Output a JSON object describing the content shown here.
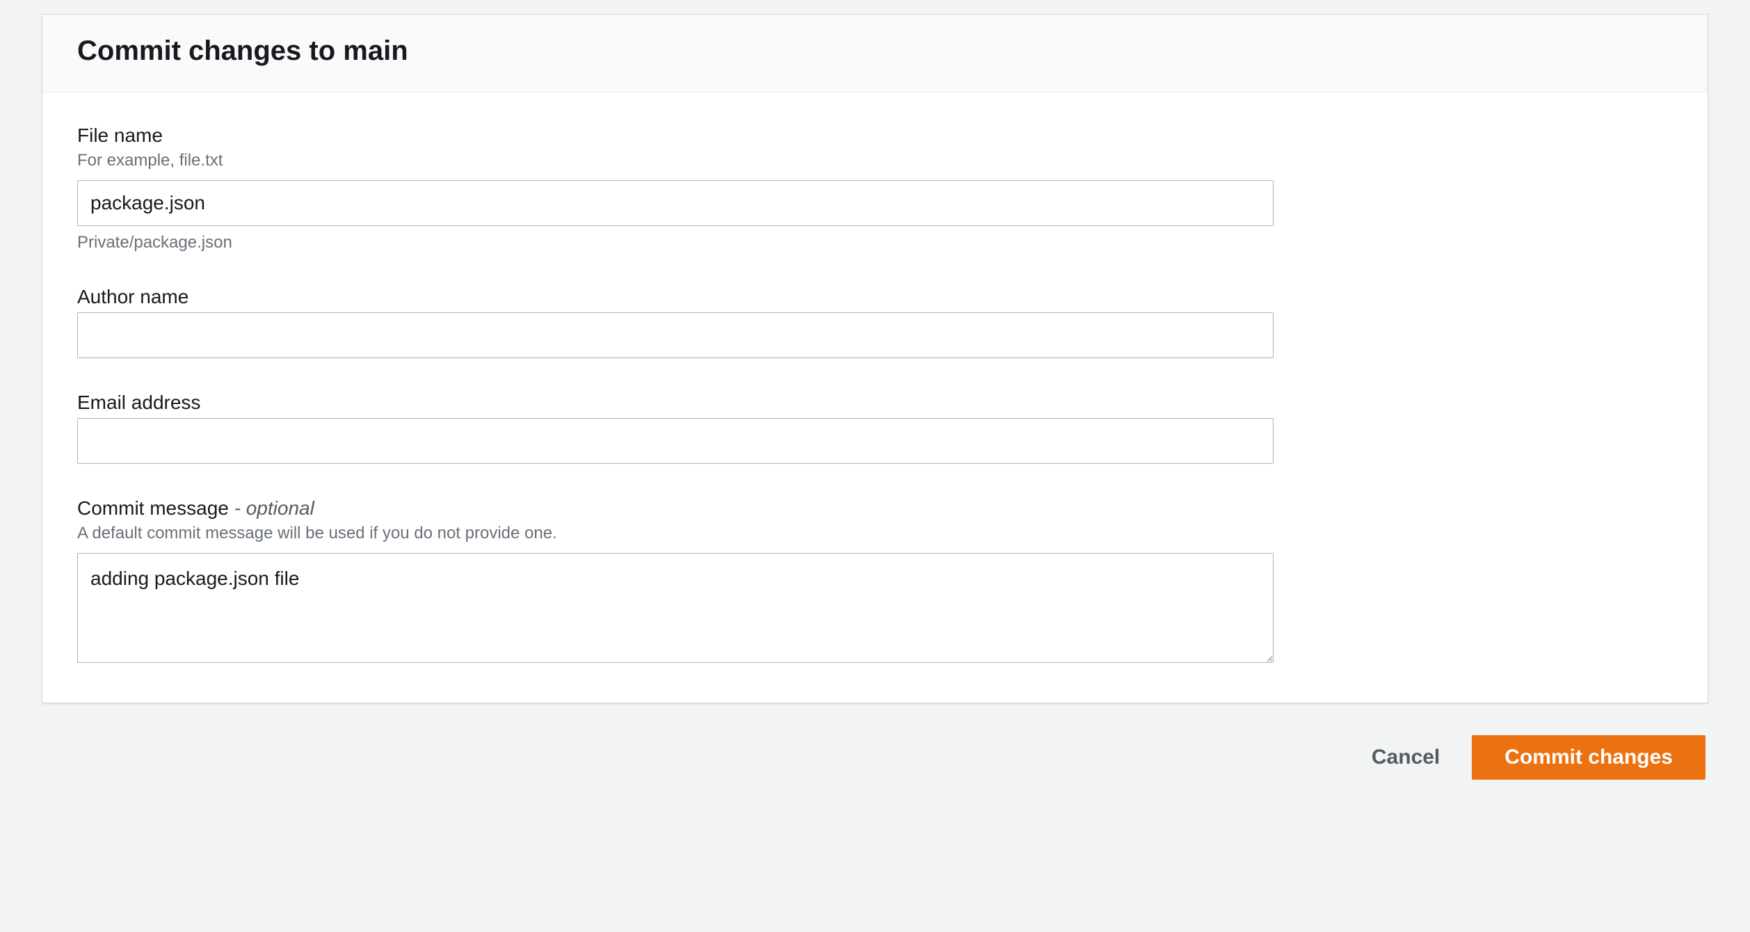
{
  "header": {
    "title": "Commit changes to main"
  },
  "form": {
    "file_name": {
      "label": "File name",
      "hint": "For example, file.txt",
      "value": "package.json",
      "path_preview": "Private/package.json"
    },
    "author_name": {
      "label": "Author name",
      "value": ""
    },
    "email": {
      "label": "Email address",
      "value": ""
    },
    "commit_message": {
      "label": "Commit message",
      "optional_suffix": " - optional",
      "hint": "A default commit message will be used if you do not provide one.",
      "value": "adding package.json file"
    }
  },
  "actions": {
    "cancel": "Cancel",
    "submit": "Commit changes"
  }
}
